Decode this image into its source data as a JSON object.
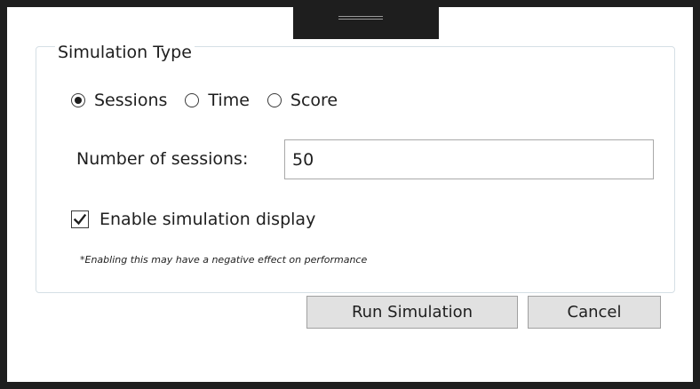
{
  "group": {
    "title": "Simulation Type",
    "radios": [
      {
        "label": "Sessions",
        "checked": true
      },
      {
        "label": "Time",
        "checked": false
      },
      {
        "label": "Score",
        "checked": false
      }
    ],
    "sessions_label": "Number of sessions:",
    "sessions_value": "50",
    "display_checkbox": {
      "label": "Enable simulation display",
      "checked": true
    },
    "note": "*Enabling this may have a negative effect on performance"
  },
  "buttons": {
    "run_label": "Run Simulation",
    "cancel_label": "Cancel"
  }
}
